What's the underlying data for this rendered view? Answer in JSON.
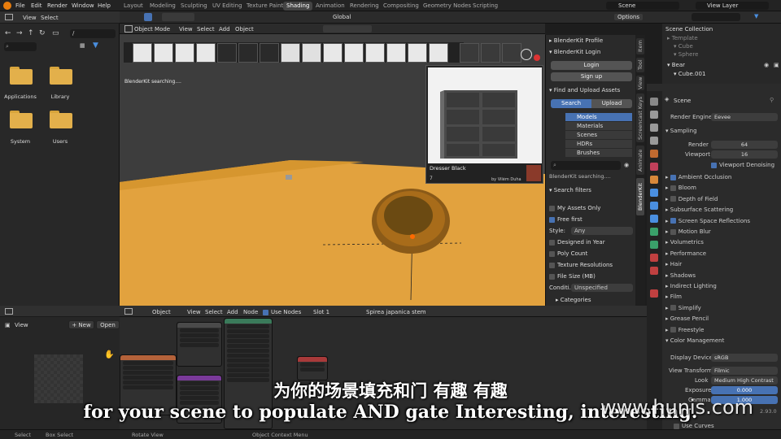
{
  "topbar": {
    "menus": [
      "File",
      "Edit",
      "Render",
      "Window",
      "Help"
    ],
    "workspaces": [
      "Layout",
      "Modeling",
      "Sculpting",
      "UV Editing",
      "Texture Paint",
      "Shading",
      "Animation",
      "Rendering",
      "Compositing",
      "Geometry Nodes",
      "Scripting"
    ],
    "active_workspace": "Shading",
    "scene": "Scene",
    "view_layer": "View Layer"
  },
  "filebrowser": {
    "menus": [
      "View",
      "Select"
    ],
    "path": "/",
    "folders": [
      "Applications",
      "Library",
      "System",
      "Users"
    ]
  },
  "viewport": {
    "mode": "Object Mode",
    "menus": [
      "View",
      "Select",
      "Add",
      "Object"
    ],
    "transform": "Global",
    "options": "Options",
    "status_text": "BlenderKit searching...."
  },
  "preview": {
    "title": "Dresser Black",
    "likes": "7",
    "author": "by Vilém Duha"
  },
  "blenderkit": {
    "profile": "BlenderKit Profile",
    "login_section": "BlenderKit Login",
    "login": "Login",
    "signup": "Sign up",
    "find_section": "Find and Upload Assets",
    "search_tab": "Search",
    "upload_tab": "Upload",
    "asset_types": [
      "Models",
      "Materials",
      "Scenes",
      "HDRs",
      "Brushes"
    ],
    "active_asset_type": "Models",
    "searching": "BlenderKit searching....",
    "filters_section": "Search filters",
    "my_assets": "My Assets Only",
    "free_first": "Free first",
    "style_label": "Style:",
    "style_value": "Any",
    "designed_in_year": "Designed in Year",
    "poly_count": "Poly Count",
    "texture_resolutions": "Texture Resolutions",
    "file_size": "File Size (MB)",
    "condition_label": "Conditi...",
    "condition_value": "Unspecified",
    "categories": "Categories"
  },
  "vtabs": [
    "Item",
    "Tool",
    "View",
    "Screencast Keys",
    "Animate",
    "BlenderKit"
  ],
  "outliner": {
    "title": "Scene Collection",
    "items": [
      {
        "name": "Template",
        "indent": 0
      },
      {
        "name": "Cube",
        "indent": 1
      },
      {
        "name": "Sphere",
        "indent": 1
      },
      {
        "name": "Bear",
        "indent": 0
      },
      {
        "name": "Cube.001",
        "indent": 1
      }
    ]
  },
  "properties": {
    "search": "",
    "scene": "Scene",
    "render_engine_label": "Render Engine",
    "render_engine": "Eevee",
    "sampling": "Sampling",
    "render_label": "Render",
    "render_value": "64",
    "viewport_label": "Viewport",
    "viewport_value": "16",
    "viewport_denoising": "Viewport Denoising",
    "panels": [
      "Ambient Occlusion",
      "Bloom",
      "Depth of Field",
      "Subsurface Scattering",
      "Screen Space Reflections",
      "Motion Blur",
      "Volumetrics",
      "Performance",
      "Hair",
      "Shadows",
      "Indirect Lighting",
      "Film",
      "Simplify",
      "Grease Pencil",
      "Freestyle",
      "Color Management"
    ],
    "checked_panels": [
      "Ambient Occlusion",
      "Screen Space Reflections"
    ],
    "display_device_label": "Display Device",
    "display_device": "sRGB",
    "view_transform_label": "View Transform",
    "view_transform": "Filmic",
    "look_label": "Look",
    "look": "Medium High Contrast",
    "exposure_label": "Exposure",
    "exposure": "0.000",
    "gamma_label": "Gamma",
    "gamma": "1.000",
    "use_curves": "Use Curves",
    "version": "2.93.0"
  },
  "nodeeditor": {
    "type": "Object",
    "menus": [
      "View",
      "Select",
      "Add",
      "Node"
    ],
    "use_nodes": "Use Nodes",
    "slot": "Slot 1",
    "material": "Spirea japanica stem"
  },
  "imageeditor": {
    "menus": [
      "View"
    ],
    "new": "+ New",
    "open": "Open"
  },
  "statusbar": {
    "items": [
      "Select",
      "Box Select",
      "Rotate View",
      "Object Context Menu"
    ]
  },
  "subtitles": {
    "chinese": "为你的场景填充和门 有趣 有趣",
    "english": "for your scene to populate AND gate Interesting, interesting."
  },
  "watermark": "www.hunis.com"
}
